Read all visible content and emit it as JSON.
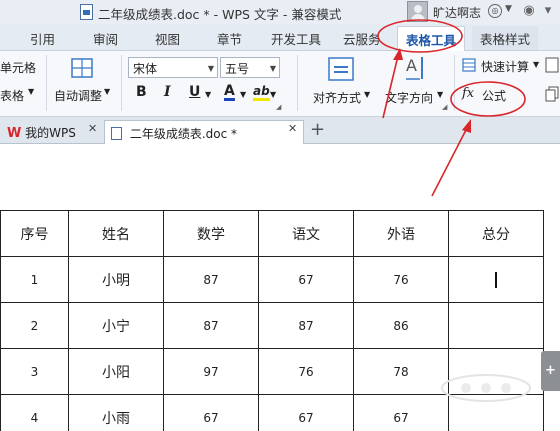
{
  "window": {
    "title": "二年级成绩表.doc * - WPS 文字 - 兼容模式",
    "user": "旷达啊志"
  },
  "tabs": [
    "引用",
    "审阅",
    "视图",
    "章节",
    "开发工具",
    "云服务",
    "表格工具",
    "表格样式"
  ],
  "ribbon": {
    "cell_group_label": "单元格",
    "table_label": "表格",
    "auto_adjust": "自动调整",
    "font_name": "宋体",
    "font_size": "五号",
    "bold": "B",
    "italic": "I",
    "underline": "U",
    "font_color": "A",
    "highlight": "ab",
    "align": "对齐方式",
    "text_direction": "文字方向",
    "quick_calc": "快速计算",
    "formula_fx": "fx",
    "formula": "公式"
  },
  "doc_tabs": {
    "home": "我的WPS",
    "current": "二年级成绩表.doc *"
  },
  "table": {
    "headers": [
      "序号",
      "姓名",
      "数学",
      "语文",
      "外语",
      "总分"
    ],
    "rows": [
      [
        "1",
        "小明",
        "87",
        "67",
        "76",
        ""
      ],
      [
        "2",
        "小宁",
        "87",
        "87",
        "86",
        ""
      ],
      [
        "3",
        "小阳",
        "97",
        "76",
        "78",
        ""
      ],
      [
        "4",
        "小雨",
        "67",
        "67",
        "67",
        ""
      ]
    ]
  },
  "colors": {
    "annotation": "#d9262b",
    "active_tab_text": "#1f57a8",
    "wps_red": "#d9262b"
  }
}
